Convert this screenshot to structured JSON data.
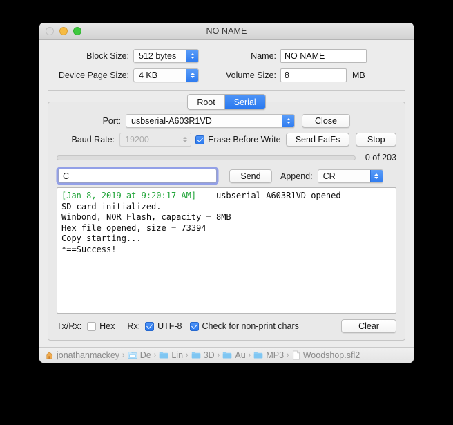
{
  "window": {
    "title": "NO NAME",
    "traffic_lights": [
      "close-inactive",
      "minimize",
      "zoom"
    ]
  },
  "topform": {
    "block_size": {
      "label": "Block Size:",
      "value": "512 bytes"
    },
    "device_page_size": {
      "label": "Device Page Size:",
      "value": "4 KB"
    },
    "name": {
      "label": "Name:",
      "value": "NO NAME"
    },
    "volume_size": {
      "label": "Volume Size:",
      "value": "8",
      "unit": "MB"
    }
  },
  "tabs": [
    {
      "label": "Root",
      "active": false
    },
    {
      "label": "Serial",
      "active": true
    }
  ],
  "serial": {
    "port": {
      "label": "Port:",
      "value": "usbserial-A603R1VD"
    },
    "close_button": "Close",
    "baud_rate": {
      "label": "Baud Rate:",
      "value": "19200",
      "disabled": true
    },
    "erase_before_write": {
      "label": "Erase Before Write",
      "checked": true
    },
    "send_fatfs_button": "Send FatFs",
    "stop_button": "Stop",
    "progress": {
      "percent": 0,
      "text": "0 of 203"
    },
    "command_input": {
      "value": "C"
    },
    "send_button": "Send",
    "append": {
      "label": "Append:",
      "value": "CR"
    },
    "terminal": [
      {
        "timestamp": "[Jan 8, 2019 at 9:20:17 AM]",
        "text": "    usbserial-A603R1VD opened"
      },
      {
        "timestamp": "",
        "text": "SD card initialized."
      },
      {
        "timestamp": "",
        "text": "Winbond, NOR Flash, capacity = 8MB"
      },
      {
        "timestamp": "",
        "text": "Hex file opened, size = 73394"
      },
      {
        "timestamp": "",
        "text": "Copy starting..."
      },
      {
        "timestamp": "",
        "text": "*==Success!"
      }
    ],
    "bottom": {
      "txrx_label": "Tx/Rx:",
      "hex": {
        "label": "Hex",
        "checked": false
      },
      "rx_label": "Rx:",
      "utf8": {
        "label": "UTF-8",
        "checked": true
      },
      "nonprint": {
        "label": "Check for non-print chars",
        "checked": true
      },
      "clear_button": "Clear"
    }
  },
  "pathbar": {
    "crumbs": [
      {
        "icon": "home-icon",
        "label": "jonathanmackey"
      },
      {
        "icon": "folder-open-icon",
        "label": "De"
      },
      {
        "icon": "folder-icon",
        "label": "Lin"
      },
      {
        "icon": "folder-icon",
        "label": "3D"
      },
      {
        "icon": "folder-icon",
        "label": "Au"
      },
      {
        "icon": "folder-icon",
        "label": "MP3"
      },
      {
        "icon": "file-icon",
        "label": "Woodshop.sfl2"
      }
    ],
    "separator": "›"
  },
  "colors": {
    "accent_blue": "#2a79ef",
    "terminal_timestamp_green": "#22a53a",
    "window_bg": "#ececec"
  }
}
